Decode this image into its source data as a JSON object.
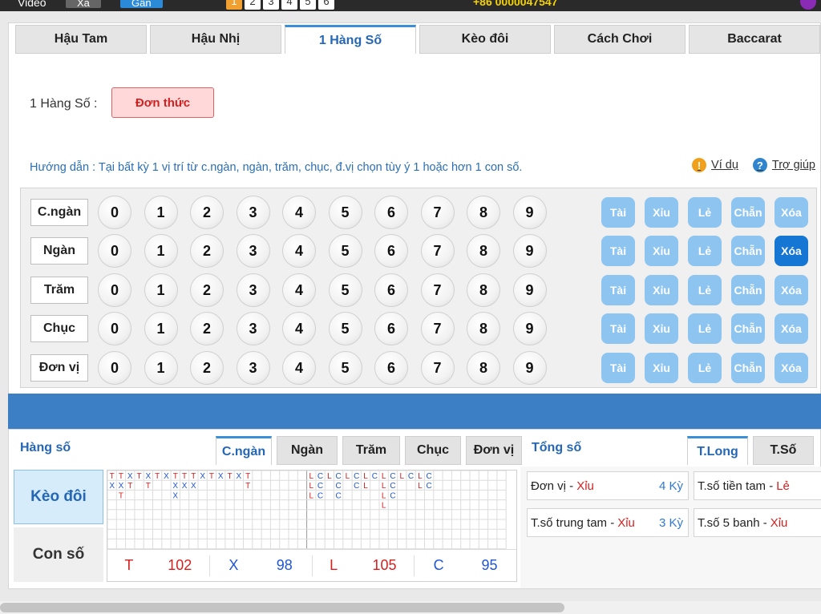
{
  "topbar": {
    "video_label": "Video",
    "xa_label": "Xa",
    "gan_label": "Gần",
    "nums": [
      "1",
      "2",
      "3",
      "4",
      "5",
      "6"
    ],
    "phone": "+86 0000047547"
  },
  "tabs": [
    "Hậu Tam",
    "Hậu Nhị",
    "1 Hàng Số",
    "Kèo đôi",
    "Cách Chơi",
    "Baccarat"
  ],
  "mode": {
    "label": "1 Hàng Số :",
    "button": "Đơn thức"
  },
  "guide": "Hướng dẫn : Tại bất kỳ 1 vị trí từ c.ngàn, ngàn, trăm, chục, đ.vị chọn tùy ý 1 hoặc hơn 1 con số.",
  "links": {
    "example": "Ví dụ",
    "help": "Trợ giúp"
  },
  "rows": [
    {
      "label": "C.ngàn"
    },
    {
      "label": "Ngàn"
    },
    {
      "label": "Trăm"
    },
    {
      "label": "Chục"
    },
    {
      "label": "Đơn vị"
    }
  ],
  "digits": [
    "0",
    "1",
    "2",
    "3",
    "4",
    "5",
    "6",
    "7",
    "8",
    "9"
  ],
  "actions": [
    "Tài",
    "Xỉu",
    "Lẻ",
    "Chẵn",
    "Xóa"
  ],
  "bottom": {
    "hang_so_title": "Hàng số",
    "subtabs": [
      "C.ngàn",
      "Ngàn",
      "Trăm",
      "Chục",
      "Đơn vị"
    ],
    "side_buttons": [
      "Kèo đôi",
      "Con số"
    ],
    "road_tx": [
      [
        "T",
        "X"
      ],
      [
        "T",
        "X",
        "T"
      ],
      [
        "X",
        "T"
      ],
      [
        "T"
      ],
      [
        "X",
        "T"
      ],
      [
        "T"
      ],
      [
        "X"
      ],
      [
        "T",
        "X",
        "X"
      ],
      [
        "T",
        "X"
      ],
      [
        "T",
        "X"
      ],
      [
        "X"
      ],
      [
        "T"
      ],
      [
        "X"
      ],
      [
        "T"
      ],
      [
        "X"
      ],
      [
        "T",
        "T"
      ]
    ],
    "road_lc": [
      [
        "L",
        "L",
        "L"
      ],
      [
        "C",
        "C",
        "C"
      ],
      [
        "L"
      ],
      [
        "C",
        "C",
        "C"
      ],
      [
        "L"
      ],
      [
        "C",
        "C"
      ],
      [
        "L",
        "L"
      ],
      [
        "C"
      ],
      [
        "L",
        "L",
        "L",
        "L"
      ],
      [
        "C",
        "C",
        "C"
      ],
      [
        "L"
      ],
      [
        "C"
      ],
      [
        "L",
        "L"
      ],
      [
        "C",
        "C"
      ]
    ],
    "tally": [
      {
        "a": "T",
        "av": "102",
        "b": "X",
        "bv": "98"
      },
      {
        "a": "L",
        "av": "105",
        "b": "C",
        "bv": "95"
      }
    ],
    "tong_so_title": "Tổng số",
    "right_tabs": [
      "T.Long",
      "T.Số"
    ],
    "stats": [
      {
        "label": "Đơn vị -",
        "value": "Xỉu",
        "ky": "4 Kỳ"
      },
      {
        "label": "T.số tiền tam -",
        "value": "Lẻ",
        "ky": ""
      },
      {
        "label": "T.số trung tam -",
        "value": "Xỉu",
        "ky": "3 Kỳ"
      },
      {
        "label": "T.số 5 banh -",
        "value": "Xỉu",
        "ky": ""
      }
    ]
  }
}
